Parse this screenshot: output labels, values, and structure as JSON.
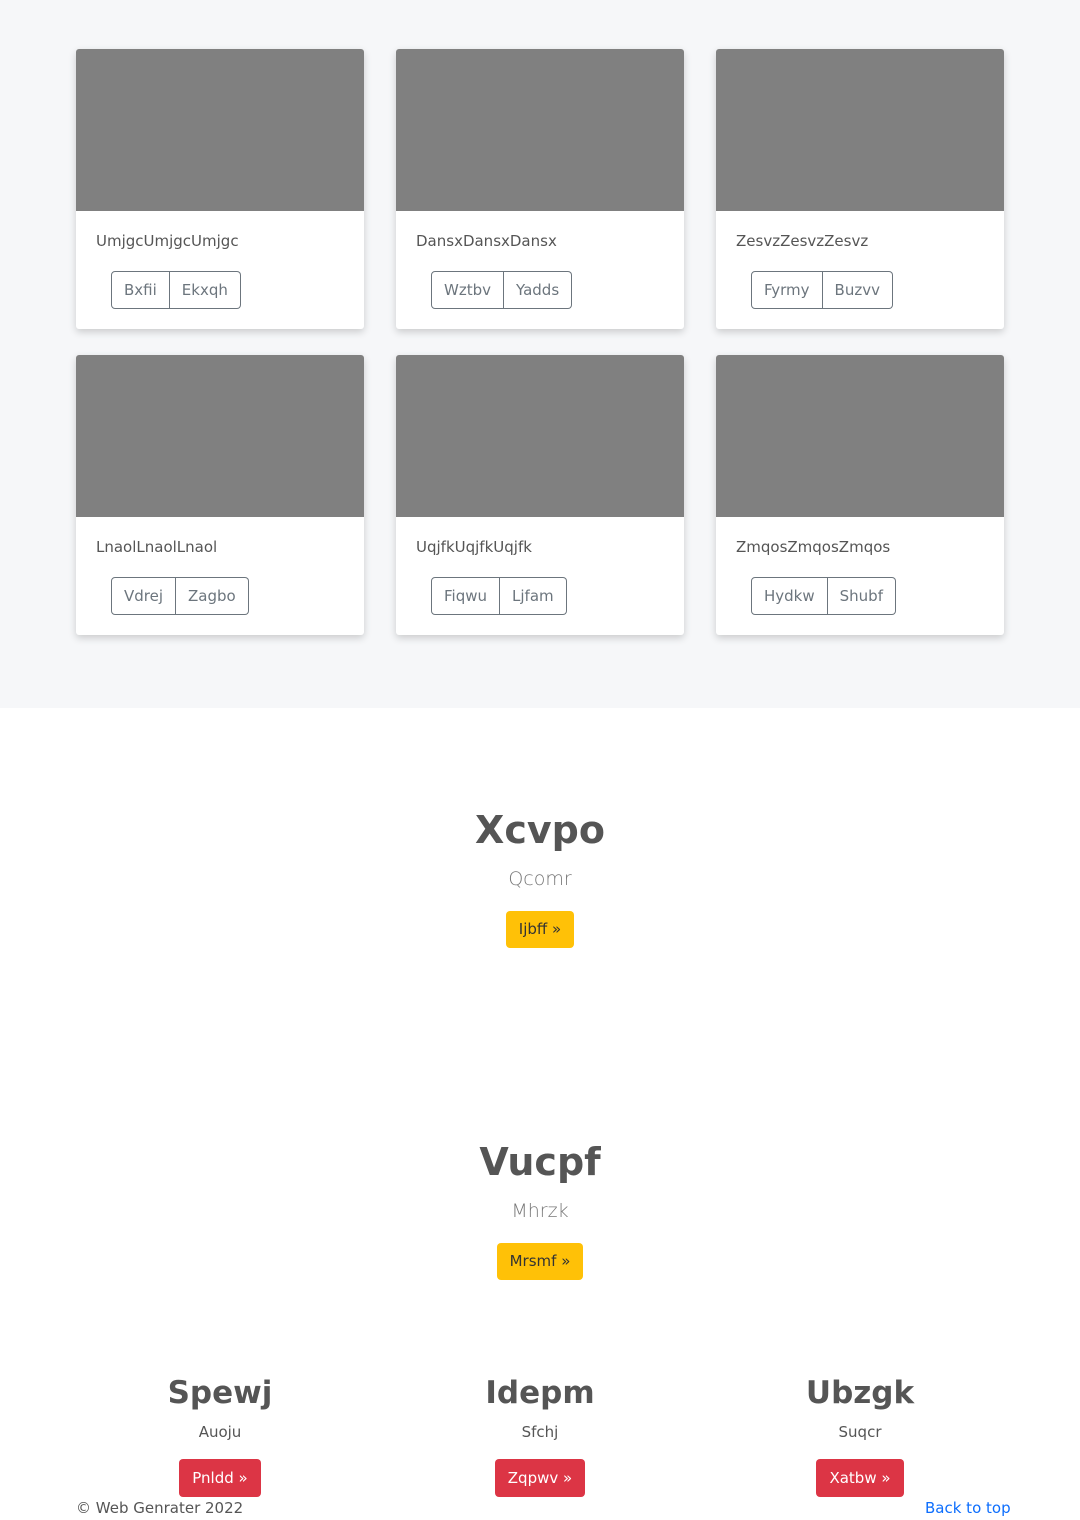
{
  "album": {
    "cards": [
      {
        "title": "UmjgcUmjgcUmjgc",
        "buttons": [
          "Bxfii",
          "Ekxqh"
        ]
      },
      {
        "title": "DansxDansxDansx",
        "buttons": [
          "Wztbv",
          "Yadds"
        ]
      },
      {
        "title": "ZesvzZesvzZesvz",
        "buttons": [
          "Fyrmy",
          "Buzvv"
        ]
      },
      {
        "title": "LnaolLnaolLnaol",
        "buttons": [
          "Vdrej",
          "Zagbo"
        ]
      },
      {
        "title": "UqjfkUqjfkUqjfk",
        "buttons": [
          "Fiqwu",
          "Ljfam"
        ]
      },
      {
        "title": "ZmqosZmqosZmqos",
        "buttons": [
          "Hydkw",
          "Shubf"
        ]
      }
    ]
  },
  "hero1": {
    "title": "Xcvpo",
    "lead": "Qcomr",
    "button": "Ijbff »"
  },
  "hero2": {
    "title": "Vucpf",
    "lead": "Mhrzk",
    "button": "Mrsmf »"
  },
  "columns": [
    {
      "title": "Spewj",
      "text": "Auoju",
      "button": "Pnldd »"
    },
    {
      "title": "Idepm",
      "text": "Sfchj",
      "button": "Zqpwv »"
    },
    {
      "title": "Ubzgk",
      "text": "Suqcr",
      "button": "Xatbw »"
    }
  ],
  "footer": {
    "copyright": "© Web Genrater 2022",
    "back_to_top": "Back to top"
  },
  "colors": {
    "album_bg": "#f6f7f9",
    "thumb": "#808080",
    "warning": "#ffc107",
    "danger": "#dc3545",
    "link": "#0d6efd"
  }
}
